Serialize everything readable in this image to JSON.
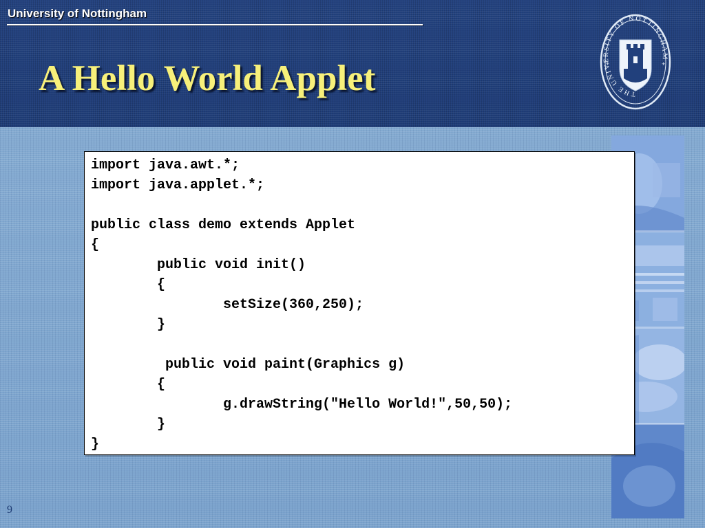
{
  "header": {
    "university_name": "University of Nottingham",
    "crest_text": "THE UNIVERSITY OF NOTTINGHAM"
  },
  "slide": {
    "title": "A Hello World Applet",
    "page_number": "9"
  },
  "code": {
    "lines": [
      "import java.awt.*;",
      "import java.applet.*;",
      "",
      "public class demo extends Applet",
      "{",
      "\tpublic void init()",
      "\t{",
      "\t\tsetSize(360,250);",
      "\t}",
      "",
      "\t public void paint(Graphics g)",
      "\t{",
      "\t\tg.drawString(\"Hello World!\",50,50);",
      "\t}",
      "}"
    ]
  },
  "colors": {
    "header_band": "#21407c",
    "title": "#f7f07a",
    "background": "#7fa7cf"
  },
  "icons": {
    "crest": "university-crest-icon"
  }
}
